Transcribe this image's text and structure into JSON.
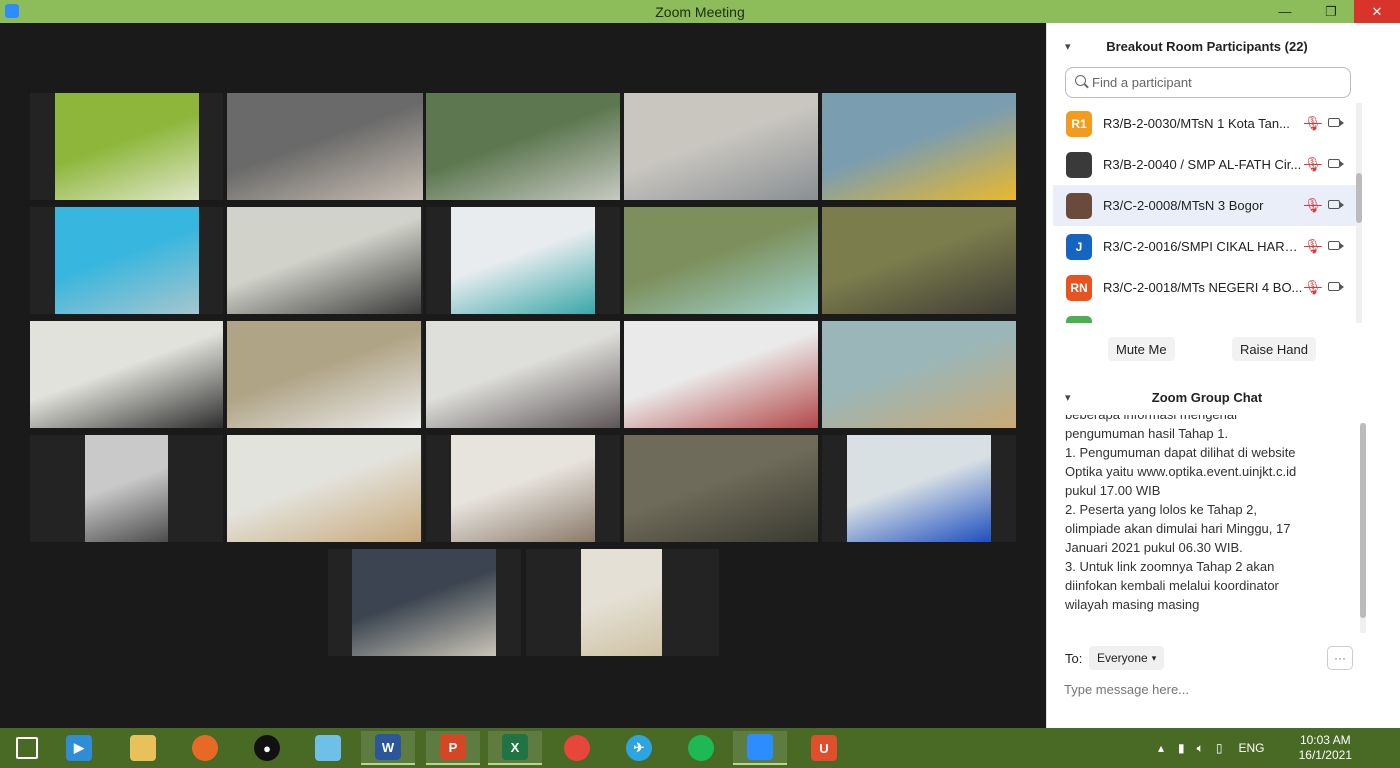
{
  "window": {
    "title": "Zoom Meeting",
    "minimize": "—",
    "maximize": "❐",
    "close": "✕"
  },
  "tiles": [
    {
      "c1": "#8db63a",
      "c2": "#dfe7c9"
    },
    {
      "c1": "#6a6a6a",
      "c2": "#c9bfb3"
    },
    {
      "c1": "#5d7750",
      "c2": "#c6c9c2"
    },
    {
      "c1": "#c9c6c0",
      "c2": "#8a8f93"
    },
    {
      "c1": "#7a9db0",
      "c2": "#e8b92c"
    },
    {
      "c1": "#37b6df",
      "c2": "#a6c6cf"
    },
    {
      "c1": "#d1d2c9",
      "c2": "#3b3b3b"
    },
    {
      "c1": "#e9ecef",
      "c2": "#3aa7a8"
    },
    {
      "c1": "#7d8f5c",
      "c2": "#9fd3cf"
    },
    {
      "c1": "#7c7d4d",
      "c2": "#3f3d35"
    },
    {
      "c1": "#e2e2dc",
      "c2": "#2e2e2e"
    },
    {
      "c1": "#b0a486",
      "c2": "#ececec"
    },
    {
      "c1": "#dededa",
      "c2": "#5d5658"
    },
    {
      "c1": "#eaeaea",
      "c2": "#b24848"
    },
    {
      "c1": "#9bb6b8",
      "c2": "#c9aa76"
    },
    {
      "c1": "#c9c9c9",
      "c2": "#4c4c4c"
    },
    {
      "c1": "#e3e3dd",
      "c2": "#c7a97b"
    },
    {
      "c1": "#e7e3dd",
      "c2": "#8a7a6a"
    },
    {
      "c1": "#6f6b5a",
      "c2": "#3a3a30"
    },
    {
      "c1": "#d9e0e3",
      "c2": "#1f4fbf"
    },
    {
      "c1": "#3b4450",
      "c2": "#c9c4b7"
    },
    {
      "c1": "#e4e0d5",
      "c2": "#cfc2a4"
    }
  ],
  "participants_panel": {
    "title": "Breakout Room Participants (22)",
    "search_placeholder": "Find a participant",
    "participants": [
      {
        "initials": "R1",
        "color": "#f29b1d",
        "name": "R3/B-2-0030/MTsN 1 Kota Tan..."
      },
      {
        "initials": "",
        "color": "#3a3a3a",
        "name": "R3/B-2-0040 / SMP AL-FATH Cir..."
      },
      {
        "initials": "",
        "color": "#6a4a3a",
        "name": "R3/C-2-0008/MTsN 3 Bogor"
      },
      {
        "initials": "J",
        "color": "#1565c0",
        "name": "R3/C-2-0016/SMPI CIKAL HARA..."
      },
      {
        "initials": "RN",
        "color": "#e8531f",
        "name": "R3/C-2-0018/MTs NEGERI 4 BO..."
      },
      {
        "initials": "",
        "color": "#4caf50",
        "name": ""
      }
    ],
    "mute_me": "Mute Me",
    "raise_hand": "Raise Hand"
  },
  "chat": {
    "title": "Zoom Group Chat",
    "lines": [
      "beberapa informasi mengenai",
      "pengumuman hasil Tahap 1.",
      "1. Pengumuman dapat dilihat di website",
      "Optika yaitu www.optika.event.uinjkt.c.id",
      "pukul 17.00 WIB",
      "2. Peserta yang lolos ke Tahap 2,",
      "olimpiade akan dimulai hari Minggu, 17",
      "Januari 2021 pukul 06.30 WIB.",
      "3. Untuk link zoomnya Tahap 2 akan",
      "diinfokan kembali melalui koordinator",
      "wilayah masing masing"
    ],
    "to_label": "To:",
    "recipient": "Everyone",
    "more": "···",
    "input_placeholder": "Type message here..."
  },
  "taskbar": {
    "apps": [
      {
        "name": "windows-start",
        "label": "",
        "color": "#ffffff"
      },
      {
        "name": "media-player",
        "label": "▶",
        "color": "#2f8dd8"
      },
      {
        "name": "file-explorer",
        "label": "",
        "color": "#e9c15b"
      },
      {
        "name": "firefox",
        "label": "",
        "color": "#e66a26"
      },
      {
        "name": "recorder",
        "label": "●",
        "color": "#111111"
      },
      {
        "name": "paint",
        "label": "",
        "color": "#6ec0e8"
      },
      {
        "name": "word",
        "label": "W",
        "color": "#2b579a"
      },
      {
        "name": "powerpoint",
        "label": "P",
        "color": "#d24726"
      },
      {
        "name": "excel",
        "label": "X",
        "color": "#217346"
      },
      {
        "name": "chrome",
        "label": "",
        "color": "#e8453c"
      },
      {
        "name": "telegram",
        "label": "✈",
        "color": "#2ca5e0"
      },
      {
        "name": "spotify",
        "label": "",
        "color": "#1db954"
      },
      {
        "name": "zoom",
        "label": "",
        "color": "#2d8cff"
      },
      {
        "name": "app",
        "label": "U",
        "color": "#e04e2b"
      }
    ],
    "lang": "ENG",
    "time": "10:03 AM",
    "date": "16/1/2021"
  }
}
